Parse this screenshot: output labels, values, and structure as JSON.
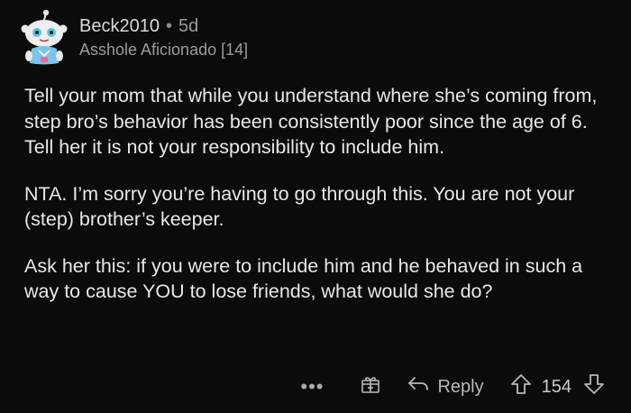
{
  "comment": {
    "author": "Beck2010",
    "separator": "•",
    "age": "5d",
    "flair": "Asshole Aficionado [14]",
    "paragraphs": [
      "Tell your mom that while you understand where she’s coming from, step bro’s behavior has been consistently poor since the age of 6. Tell her it is not your responsibility to include him.",
      "NTA. I’m sorry you’re having to go through this. You are not your (step) brother’s keeper.",
      "Ask her this: if you were to include him and he behaved in such a way to cause YOU to lose friends, what would she do?"
    ]
  },
  "actions": {
    "more": "•••",
    "reply_label": "Reply",
    "score": "154"
  },
  "icons": {
    "avatar": "snoo-avatar",
    "award": "award-gift-icon",
    "reply": "reply-arrow-icon",
    "upvote": "upvote-arrow-icon",
    "downvote": "downvote-arrow-icon"
  },
  "colors": {
    "background": "#0b0b0b",
    "text": "#e6e8ea",
    "muted": "#9a9c9e"
  }
}
